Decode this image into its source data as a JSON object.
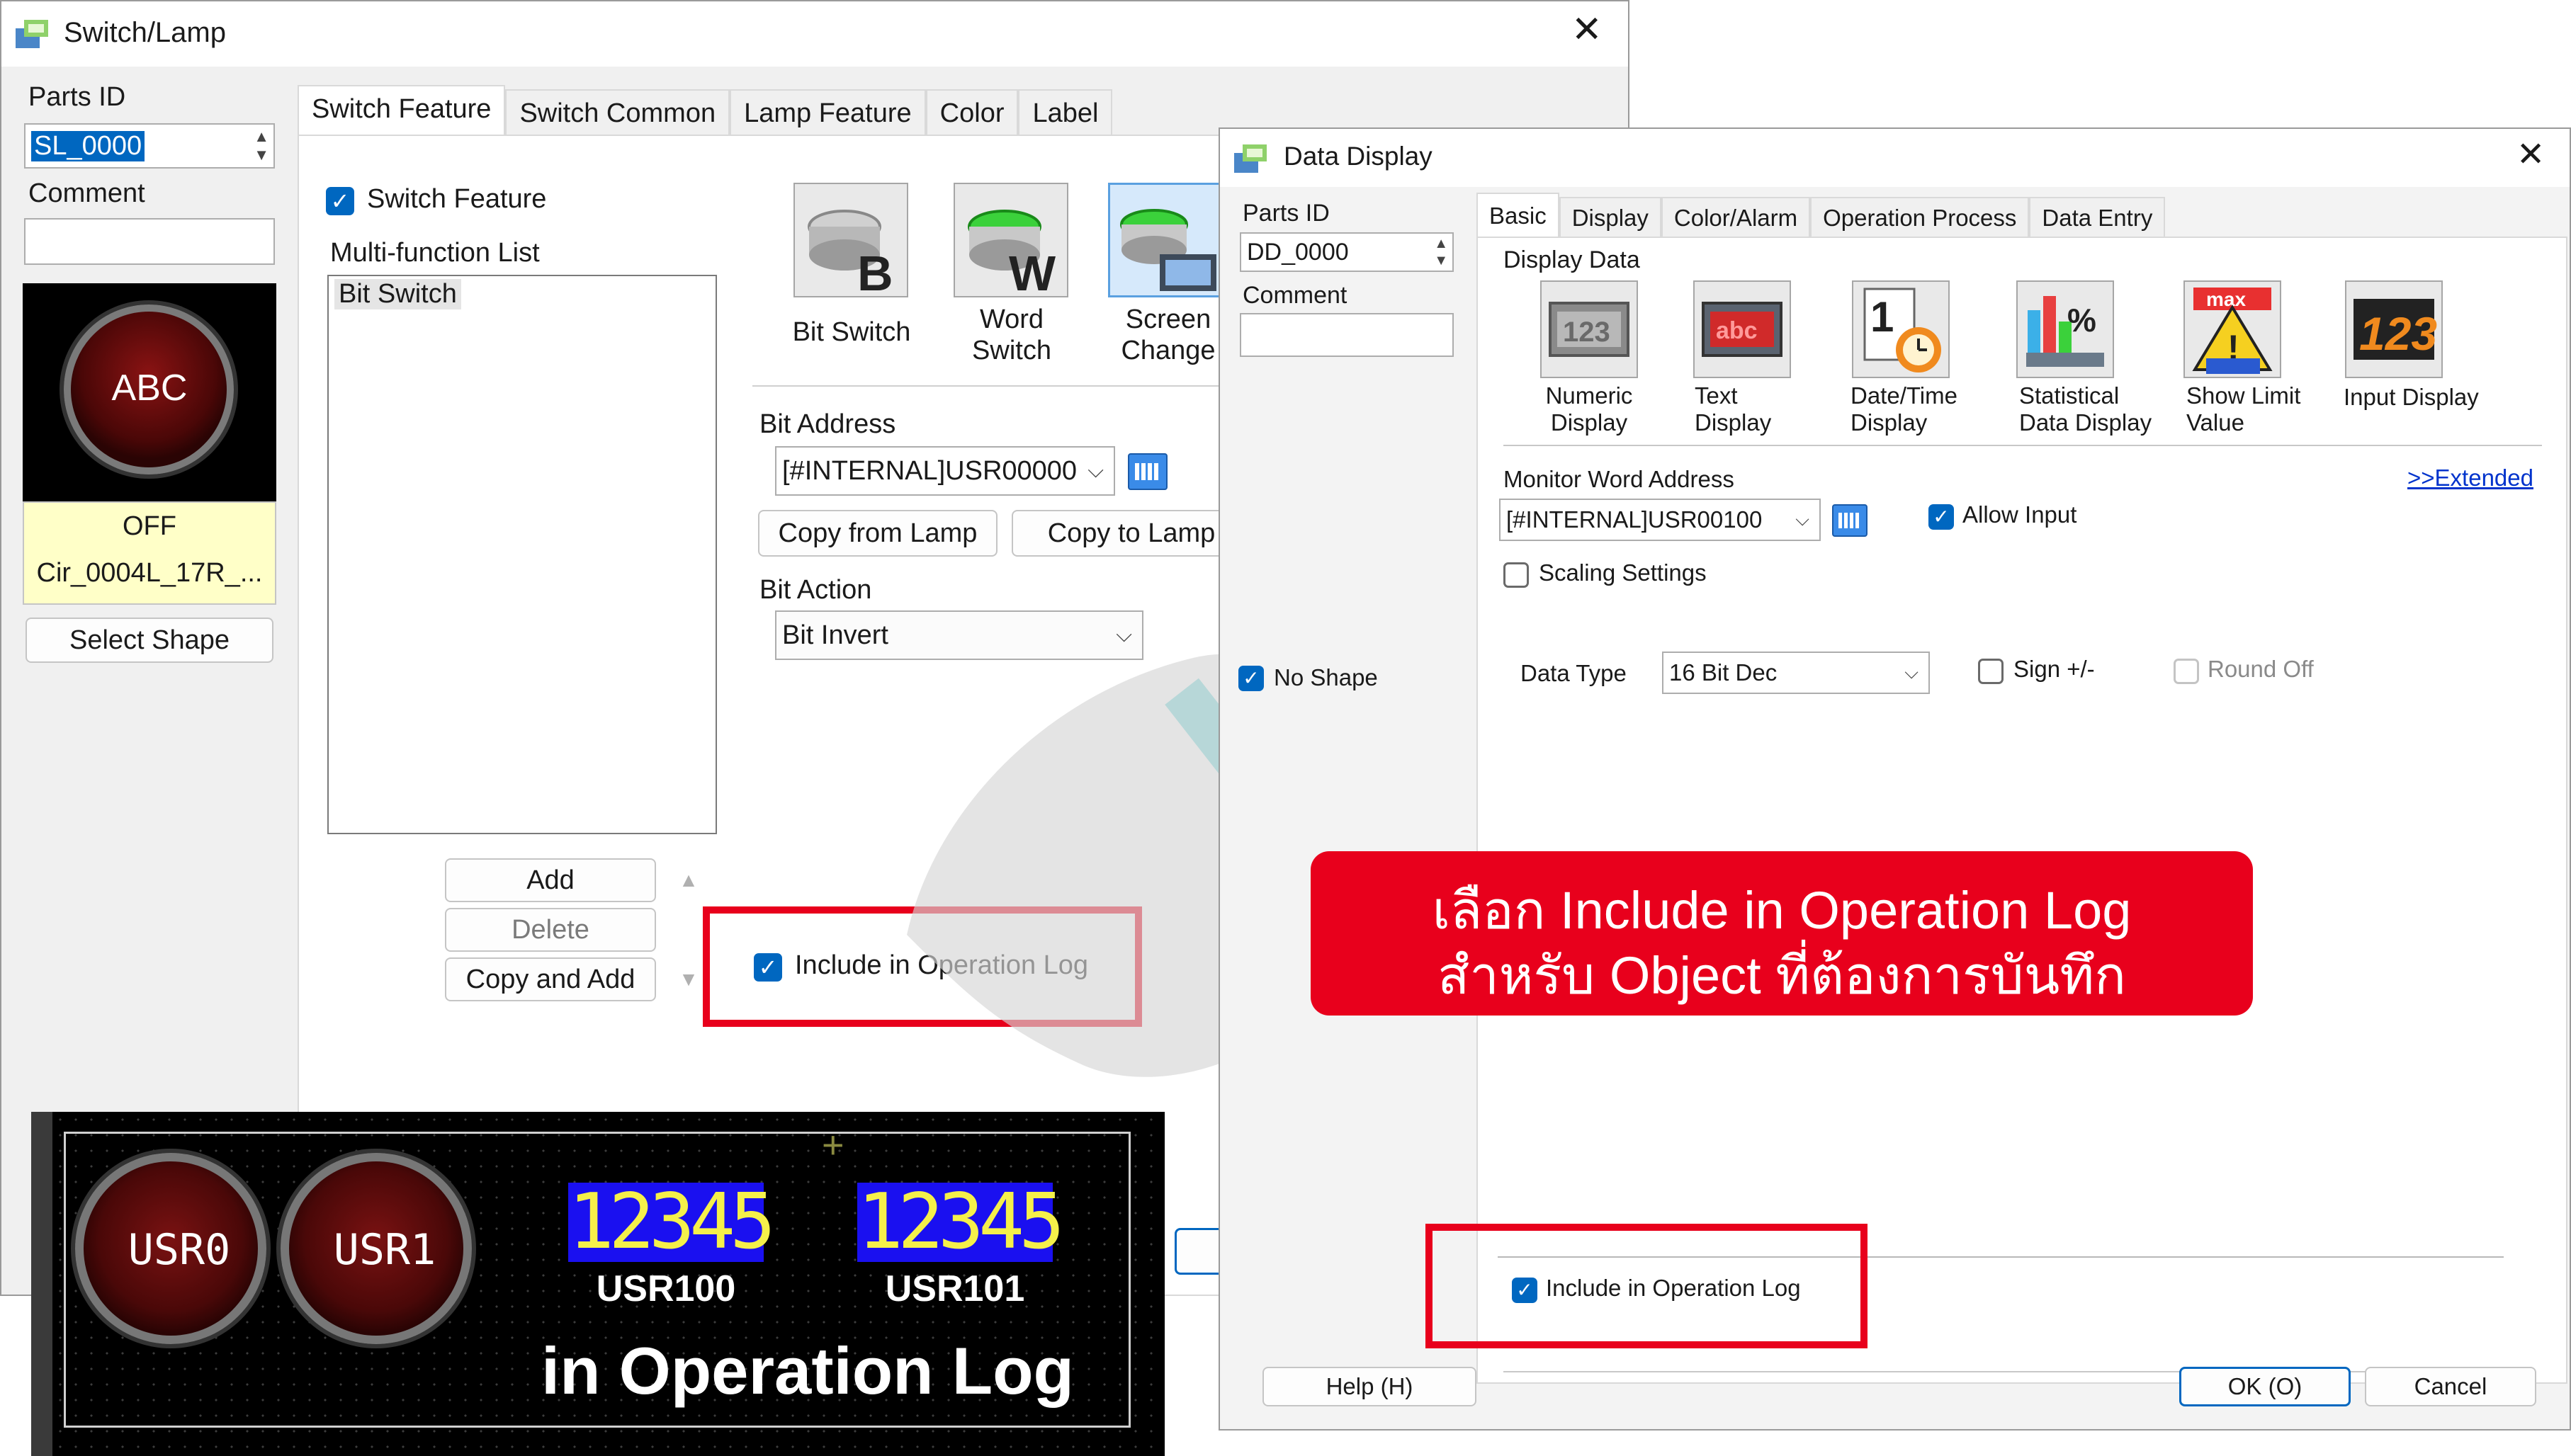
{
  "switch_lamp": {
    "title": "Switch/Lamp",
    "parts_id_label": "Parts ID",
    "parts_id_value": "SL_0000",
    "comment_label": "Comment",
    "preview_text": "ABC",
    "preview_state": "OFF",
    "preview_shape": "Cir_0004L_17R_...",
    "select_shape": "Select Shape",
    "tabs": [
      "Switch Feature",
      "Switch Common",
      "Lamp Feature",
      "Color",
      "Label"
    ],
    "switch_feature_checkbox": "Switch Feature",
    "multi_function_label": "Multi-function List",
    "list_items": [
      "Bit Switch"
    ],
    "types": [
      {
        "line1": "Bit Switch",
        "line2": "",
        "icon": "bit-switch-icon"
      },
      {
        "line1": "Word",
        "line2": "Switch",
        "icon": "word-switch-icon"
      },
      {
        "line1": "Screen",
        "line2": "Change",
        "icon": "screen-change-icon"
      }
    ],
    "bit_address_label": "Bit Address",
    "bit_address_value": "[#INTERNAL]USR00000",
    "copy_from_lamp": "Copy from Lamp",
    "copy_to_lamp": "Copy to Lamp",
    "bit_action_label": "Bit Action",
    "bit_action_value": "Bit Invert",
    "add": "Add",
    "delete": "Delete",
    "copy_and_add": "Copy and Add",
    "include_log": "Include in Operation Log"
  },
  "data_display": {
    "title": "Data Display",
    "parts_id_label": "Parts ID",
    "parts_id_value": "DD_0000",
    "comment_label": "Comment",
    "no_shape": "No Shape",
    "tabs": [
      "Basic",
      "Display",
      "Color/Alarm",
      "Operation Process",
      "Data Entry"
    ],
    "display_data_label": "Display Data",
    "types": [
      {
        "line1": "Numeric",
        "line2": "Display",
        "icon": "numeric-display-icon"
      },
      {
        "line1": "Text",
        "line2": "Display",
        "icon": "text-display-icon"
      },
      {
        "line1": "Date/Time",
        "line2": "Display",
        "icon": "date-time-display-icon"
      },
      {
        "line1": "Statistical",
        "line2": "Data Display",
        "icon": "statistical-data-display-icon"
      },
      {
        "line1": "Show Limit",
        "line2": "Value",
        "icon": "show-limit-value-icon"
      },
      {
        "line1": "Input Display",
        "line2": "",
        "icon": "input-display-icon"
      }
    ],
    "monitor_label": "Monitor Word Address",
    "extended_link": ">>Extended",
    "monitor_value": "[#INTERNAL]USR00100",
    "allow_input": "Allow Input",
    "scaling": "Scaling Settings",
    "data_type_label": "Data Type",
    "data_type_value": "16 Bit Dec",
    "sign": "Sign +/-",
    "round_off": "Round Off",
    "include_log": "Include in Operation Log",
    "help": "Help (H)",
    "ok": "OK (O)",
    "cancel": "Cancel"
  },
  "callout": {
    "line1": "เลือก Include in Operation Log",
    "line2": "สำหรับ Object ที่ต้องการบันทึก"
  },
  "hmi_preview": {
    "buttons": [
      "USR0",
      "USR1"
    ],
    "displays": [
      {
        "value": "12345",
        "label": "USR100"
      },
      {
        "value": "12345",
        "label": "USR101"
      }
    ],
    "caption": "in Operation Log"
  },
  "colors": {
    "accent": "#0067c0",
    "highlight_red": "#e8001c",
    "numeric_blue": "#1a10f0",
    "numeric_text": "#f5f04a"
  }
}
